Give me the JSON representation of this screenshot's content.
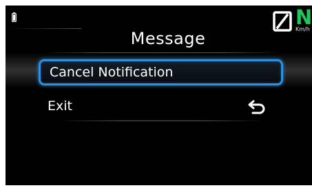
{
  "header": {
    "title": "Message",
    "status_icon": "battery-icon"
  },
  "speed": {
    "value": "N",
    "unit": "Km/h",
    "icon": "speed-gauge-icon",
    "value_color": "#22c55e"
  },
  "menu": {
    "selected_border_color": "#2f8fe0",
    "items": [
      {
        "label": "Cancel Notification",
        "selected": true
      },
      {
        "label": "Exit",
        "selected": false,
        "icon": "back-arrow-icon"
      }
    ]
  }
}
